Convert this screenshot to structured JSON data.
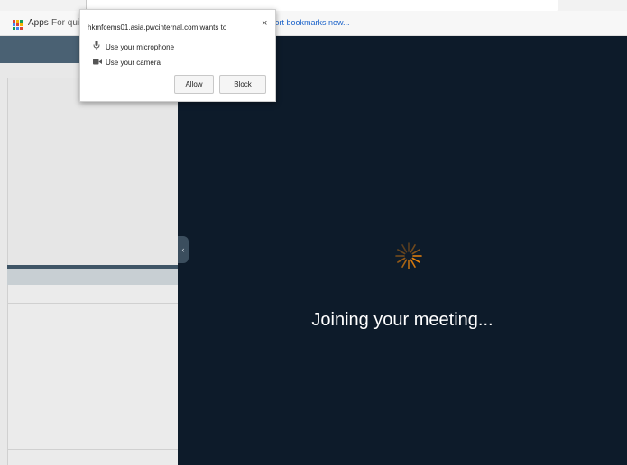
{
  "browser": {
    "bookmarks": {
      "apps_label": "Apps",
      "truncated_item": "For quick",
      "import_link": "mport bookmarks now..."
    }
  },
  "permission_popup": {
    "title": "hkmfcems01.asia.pwcinternal.com wants to",
    "close_glyph": "×",
    "items": [
      {
        "icon": "microphone-icon",
        "label": "Use your microphone"
      },
      {
        "icon": "camera-icon",
        "label": "Use your camera"
      }
    ],
    "allow_label": "Allow",
    "block_label": "Block"
  },
  "meeting": {
    "status_text": "Joining your meeting...",
    "collapse_glyph": "‹"
  },
  "colors": {
    "meeting_bg": "#0d1b2a",
    "spinner": "#e8820c",
    "left_header": "#4a6173"
  }
}
